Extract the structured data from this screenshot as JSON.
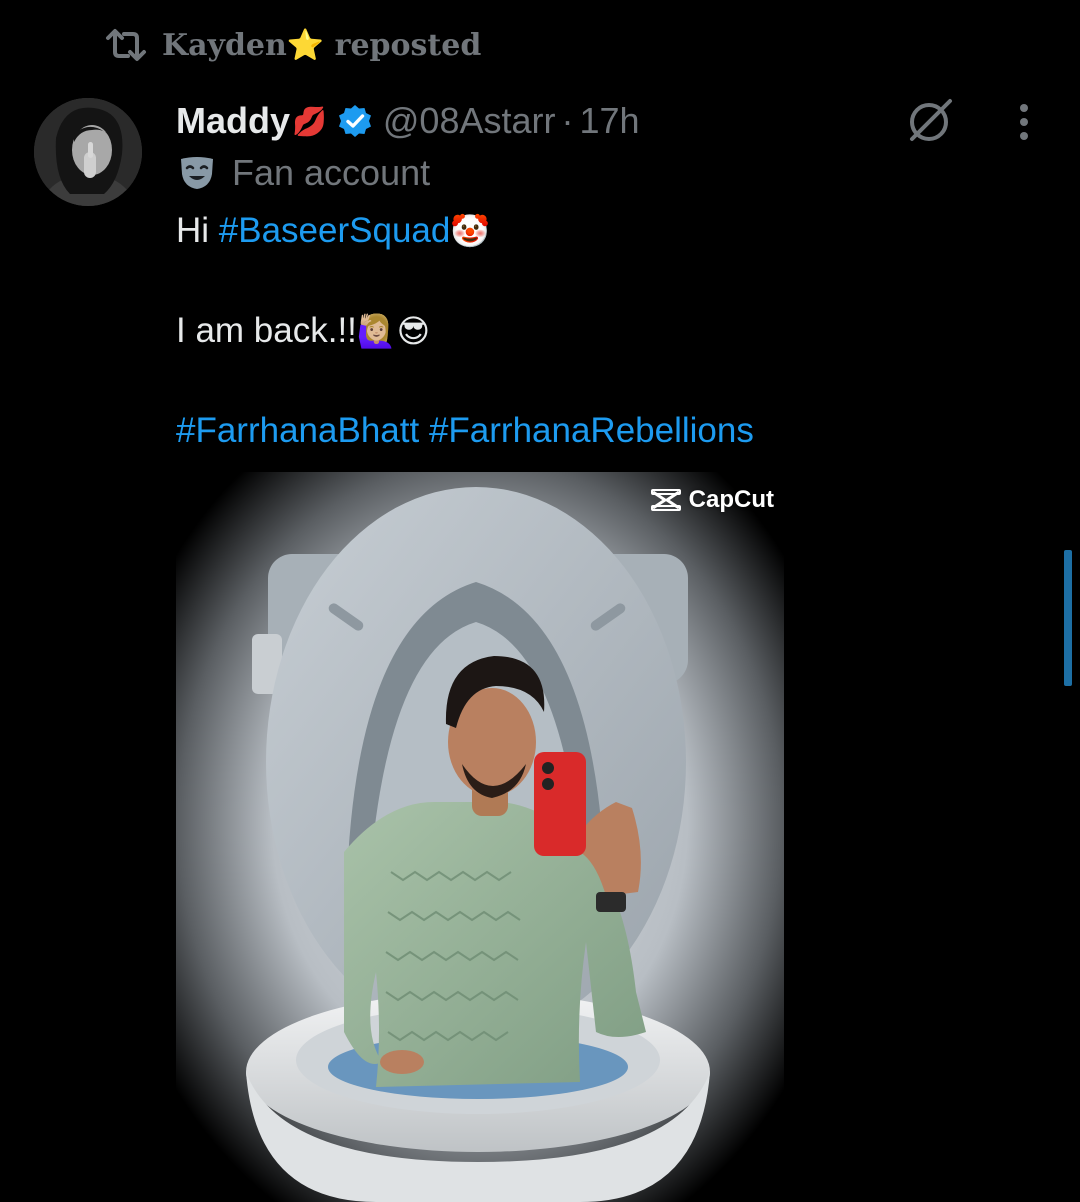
{
  "repost": {
    "icon": "repost-icon",
    "user": "Kayden",
    "user_emoji": "⭐",
    "label": "reposted"
  },
  "author": {
    "avatar": "avatar",
    "display_name": "Maddy",
    "name_emoji": "💋",
    "verified_icon": "verified-badge-icon",
    "handle": "@08Astarr",
    "separator": "·",
    "time": "17h",
    "affiliation_icon": "theater-mask-icon",
    "affiliation": "Fan account"
  },
  "actions": {
    "grok_icon": "grok-icon",
    "more_icon": "more-vertical-icon"
  },
  "tweet": {
    "line1_text": "Hi ",
    "line1_hashtag": "#BaseerSquad",
    "line1_emoji": "🤡",
    "line2_text": "I am back.!!",
    "line2_emojis": "🙋🏼‍♀️😎",
    "line3_hashtag1": "#FarrhanaBhatt",
    "line3_space": " ",
    "line3_hashtag2": "#FarrhanaRebellions"
  },
  "media": {
    "watermark": "CapCut",
    "watermark_icon": "capcut-logo-icon",
    "description_icon": "tweet-image"
  },
  "colors": {
    "background": "#000000",
    "text": "#e7e9ea",
    "muted": "#71767b",
    "link": "#1d9bf0",
    "verified": "#1d9bf0",
    "scrollbar": "#1d6fa5"
  }
}
